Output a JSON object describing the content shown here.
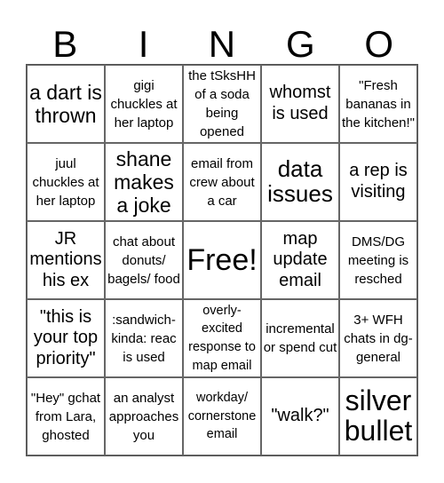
{
  "header": {
    "letters": [
      "B",
      "I",
      "N",
      "G",
      "O"
    ]
  },
  "cells": [
    [
      "a dart is thrown",
      "gigi chuckles at her laptop",
      "the tSksHH of a soda being opened",
      "whomst is used",
      "\"Fresh bananas in the kitchen!\""
    ],
    [
      "juul chuckles at her laptop",
      "shane makes a joke",
      "email from crew about a car",
      "data issues",
      "a rep is visiting"
    ],
    [
      "JR mentions his ex",
      "chat about donuts/ bagels/ food",
      "Free!",
      "map update email",
      "DMS/DG meeting is resched"
    ],
    [
      "\"this is your top priority\"",
      ":sandwich-kinda: reac is used",
      "overly-excited response to map email",
      "incremental or spend cut",
      "3+ WFH chats in dg-general"
    ],
    [
      "\"Hey\" gchat from Lara, ghosted",
      "an analyst approaches you",
      "workday/ cornerstone email",
      "\"walk?\"",
      "silver bullet"
    ]
  ]
}
